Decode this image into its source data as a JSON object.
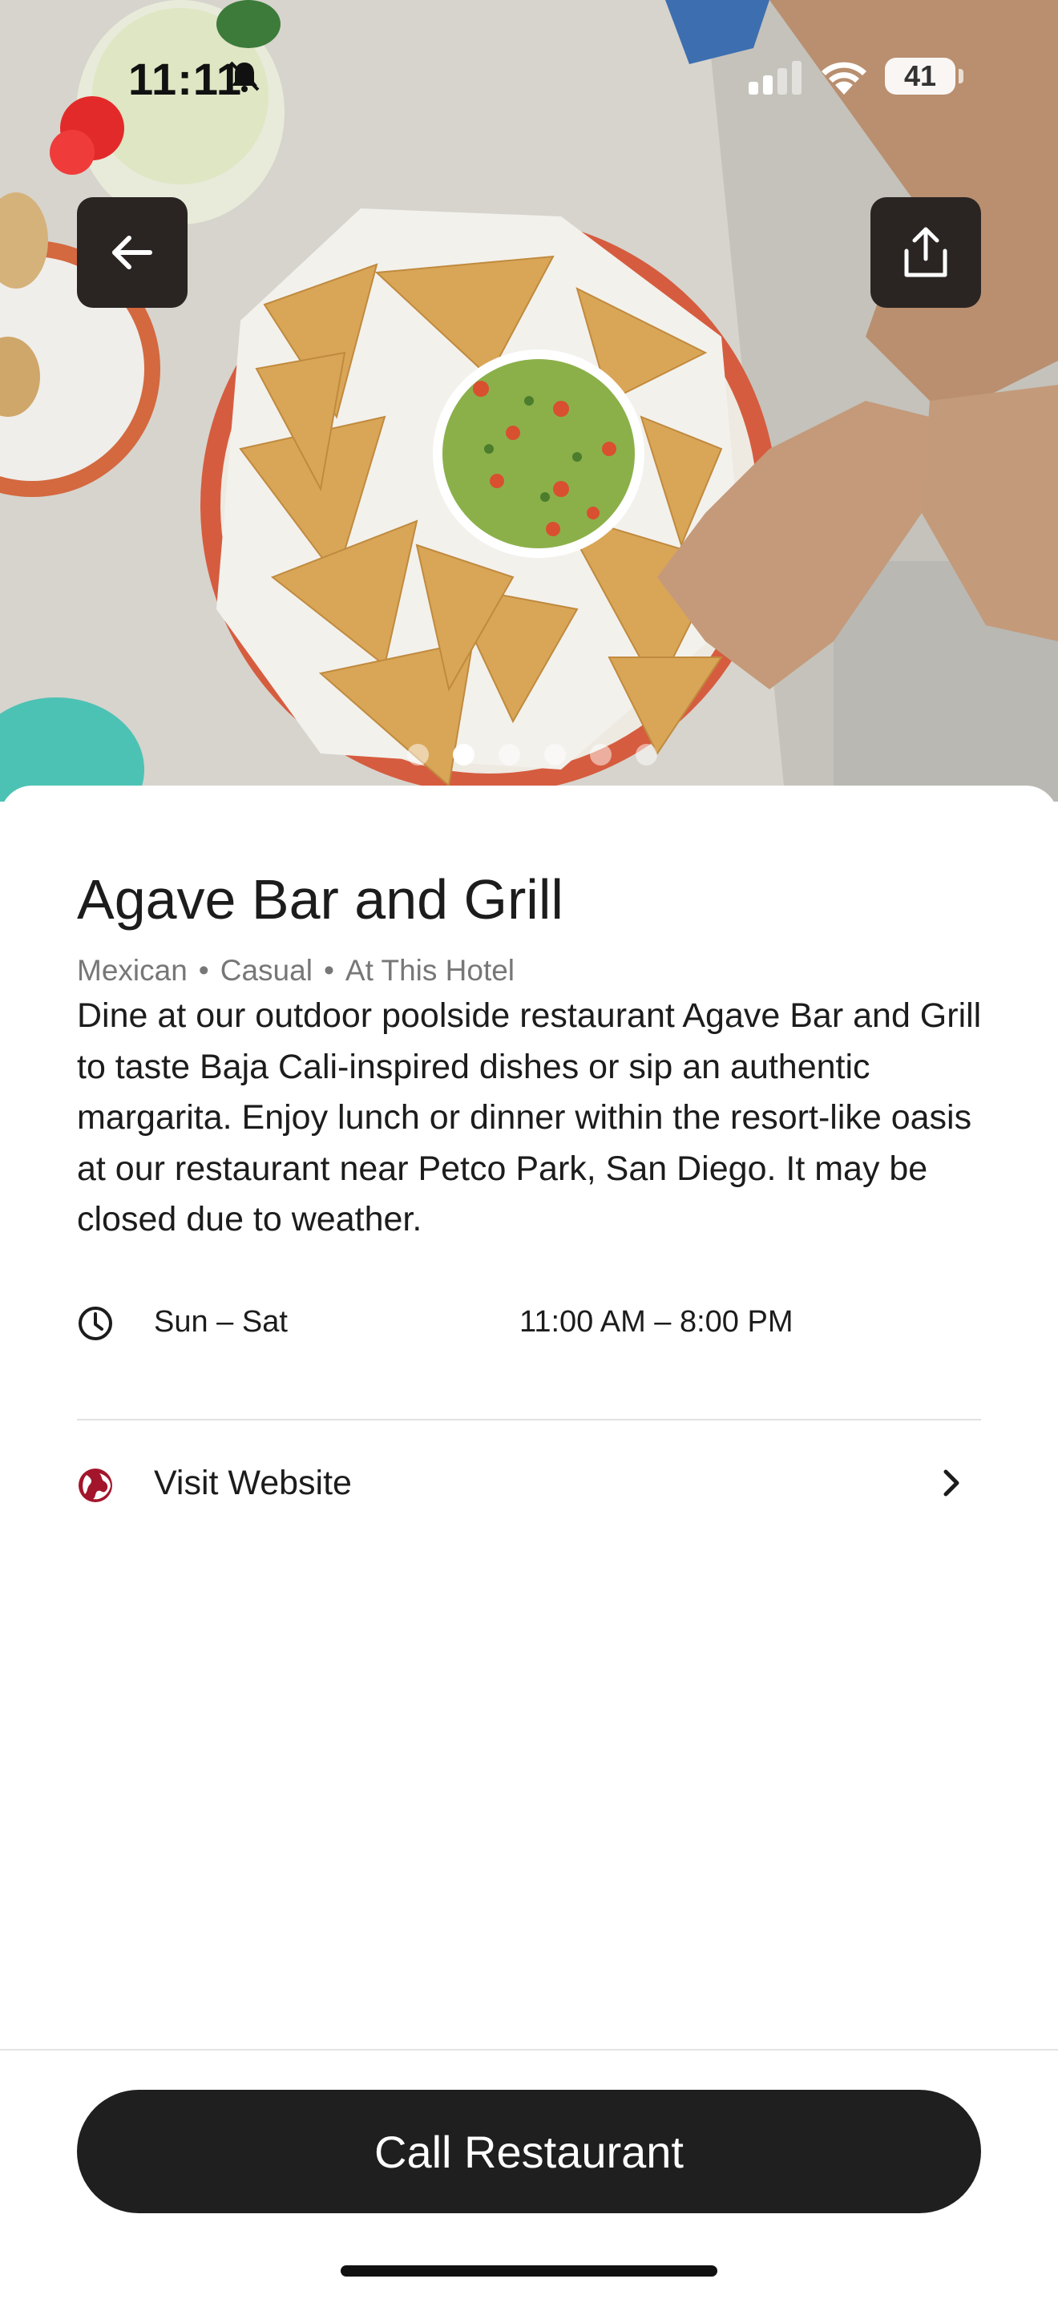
{
  "status_bar": {
    "time": "11:11",
    "battery": "41",
    "icons": [
      "bell-slash-icon",
      "cellular-signal-icon",
      "wifi-icon",
      "battery-icon"
    ]
  },
  "hero": {
    "back_icon": "arrow-left-icon",
    "share_icon": "share-icon",
    "image_count": 6,
    "active_image_index": 1
  },
  "restaurant": {
    "name": "Agave Bar and Grill",
    "tags": [
      "Mexican",
      "Casual",
      "At This Hotel"
    ],
    "tag_separator": "•",
    "description": "Dine at our outdoor poolside restaurant Agave Bar and Grill to taste Baja Cali-inspired dishes or sip an authentic margarita. Enjoy lunch or dinner within the resort-like oasis at our restaurant near Petco Park, San Diego. It may be closed due to weather."
  },
  "hours": {
    "icon": "clock-icon",
    "days": "Sun – Sat",
    "time": "11:00 AM – 8:00 PM"
  },
  "website": {
    "icon": "globe-icon",
    "label": "Visit Website",
    "chevron": "chevron-right-icon"
  },
  "cta": {
    "label": "Call Restaurant"
  },
  "colors": {
    "accent_red": "#a3152b",
    "button_dark": "#1f1f1f",
    "meta_gray": "#777777"
  }
}
